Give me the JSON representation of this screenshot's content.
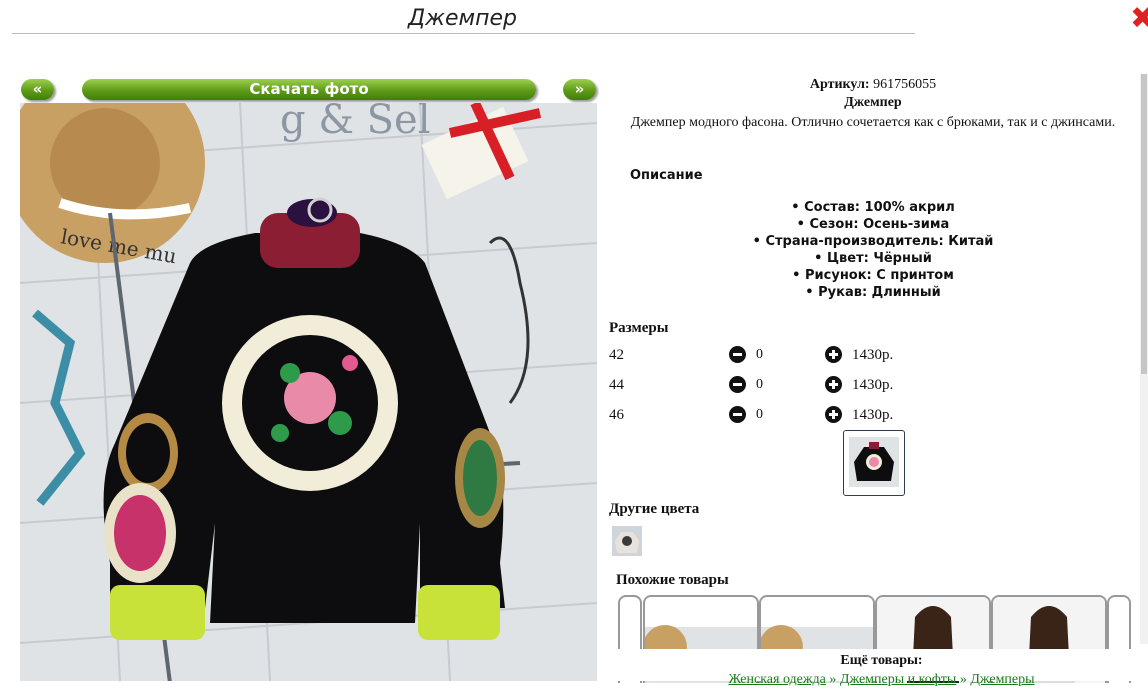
{
  "page": {
    "title": "Джемпер"
  },
  "nav": {
    "prev_label": "«",
    "download_label": "Скачать фото",
    "next_label": "»"
  },
  "product": {
    "article_label": "Артикул:",
    "article_value": "961756055",
    "name": "Джемпер",
    "description": "Джемпер модного фасона. Отлично сочетается как с брюками, так и с джинсами.",
    "description_heading": "Описание",
    "properties": [
      "Состав: 100% акрил",
      "Сезон: Осень-зима",
      "Страна-производитель: Китай",
      "Цвет: Чёрный",
      "Рисунок: С принтом",
      "Рукав: Длинный"
    ]
  },
  "sizes": {
    "heading": "Размеры",
    "rows": [
      {
        "size": "42",
        "qty": "0",
        "price": "1430р."
      },
      {
        "size": "44",
        "qty": "0",
        "price": "1430р."
      },
      {
        "size": "46",
        "qty": "0",
        "price": "1430р."
      }
    ]
  },
  "other_colors": {
    "heading": "Другие цвета"
  },
  "similar": {
    "heading": "Похожие товары"
  },
  "more": {
    "heading": "Ещё товары:",
    "crumbs": [
      "Женская одежда",
      "Джемперы и кофты",
      "Джемперы"
    ],
    "separator": "»"
  },
  "icons": {
    "close": "close-icon",
    "minus": "minus-circle-icon",
    "plus": "plus-circle-icon"
  },
  "colors": {
    "accent_green": "#5f9b18",
    "link_green": "#1a7a1a",
    "close_red": "#dd2222"
  }
}
